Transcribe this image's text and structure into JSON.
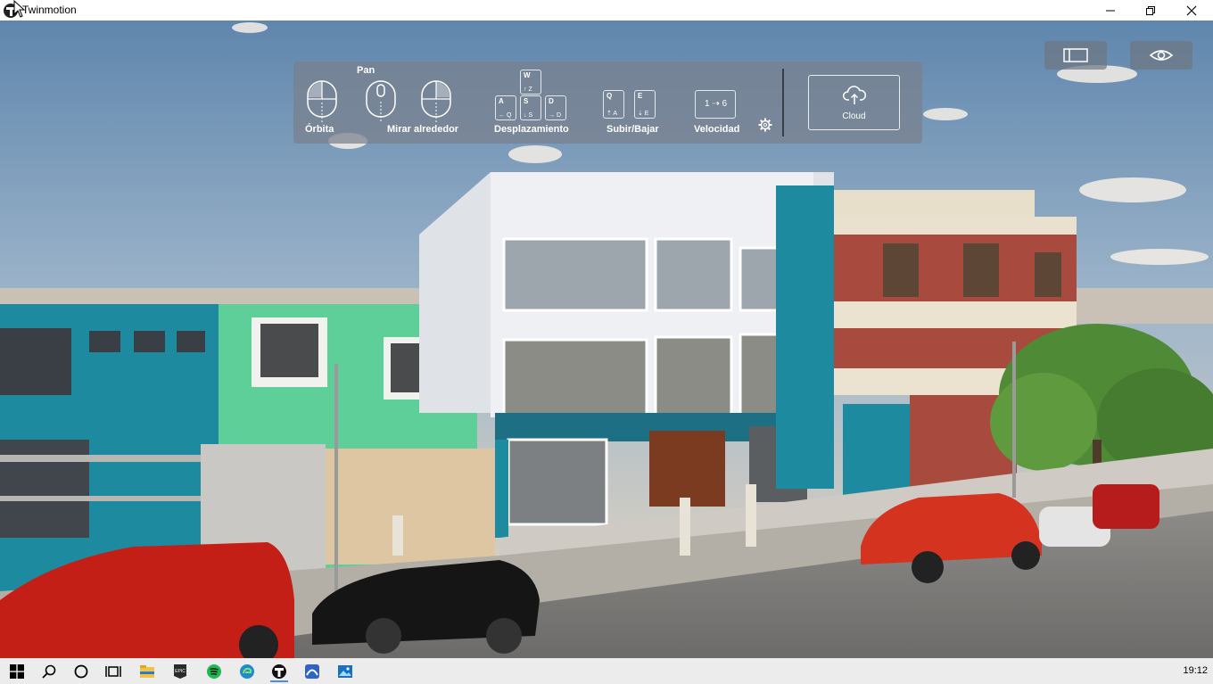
{
  "window": {
    "title": "Twinmotion"
  },
  "nav": {
    "orbit_label": "Órbita",
    "pan_label": "Pan",
    "look_label": "Mirar alrededor",
    "move_label": "Desplazamiento",
    "updown_label": "Subir/Bajar",
    "speed_label": "Velocidad",
    "speed_range": "1 ⇢ 6",
    "keys": {
      "w": {
        "key": "W",
        "sub": "↑ Z"
      },
      "a": {
        "key": "A",
        "sub": "← Q"
      },
      "s": {
        "key": "S",
        "sub": "↓ S"
      },
      "d": {
        "key": "D",
        "sub": "→ D"
      },
      "q": {
        "key": "Q",
        "sub": "⇡ A"
      },
      "e": {
        "key": "E",
        "sub": "⇣ E"
      }
    },
    "cloud_label": "Cloud"
  },
  "taskbar": {
    "clock": "19:12",
    "apps": [
      "start-icon",
      "search-icon",
      "cortana-icon",
      "task-view-icon",
      "file-explorer-icon",
      "epic-games-icon",
      "spotify-icon",
      "edge-icon",
      "twinmotion-icon",
      "photos-app-icon",
      "photos-icon"
    ]
  },
  "colors": {
    "panel": "#78808c",
    "taskbar": "#ececec",
    "accent": "#4e8ddb"
  }
}
